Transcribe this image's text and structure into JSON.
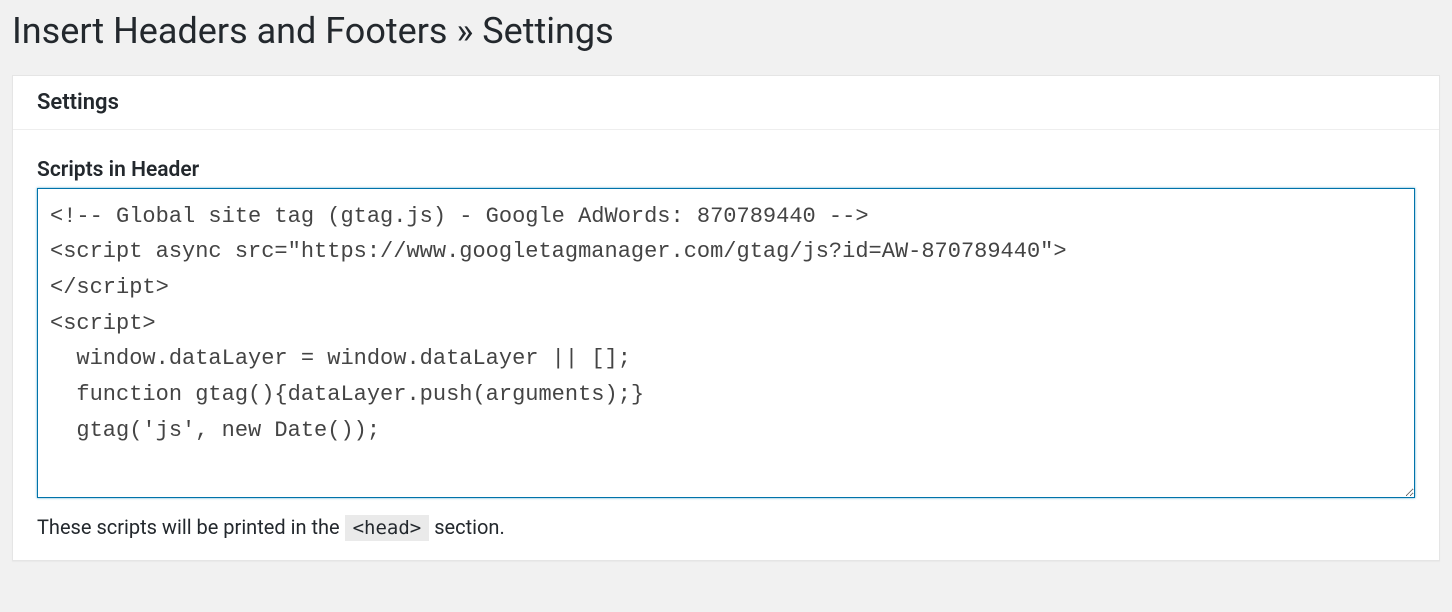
{
  "page": {
    "title": "Insert Headers and Footers » Settings"
  },
  "card": {
    "title": "Settings"
  },
  "field": {
    "label": "Scripts in Header",
    "value": "<!-- Global site tag (gtag.js) - Google AdWords: 870789440 -->\n<script async src=\"https://www.googletagmanager.com/gtag/js?id=AW-870789440\">\n</script>\n<script>\n  window.dataLayer = window.dataLayer || [];\n  function gtag(){dataLayer.push(arguments);}\n  gtag('js', new Date());",
    "help_prefix": "These scripts will be printed in the ",
    "help_code": "<head>",
    "help_suffix": " section."
  }
}
